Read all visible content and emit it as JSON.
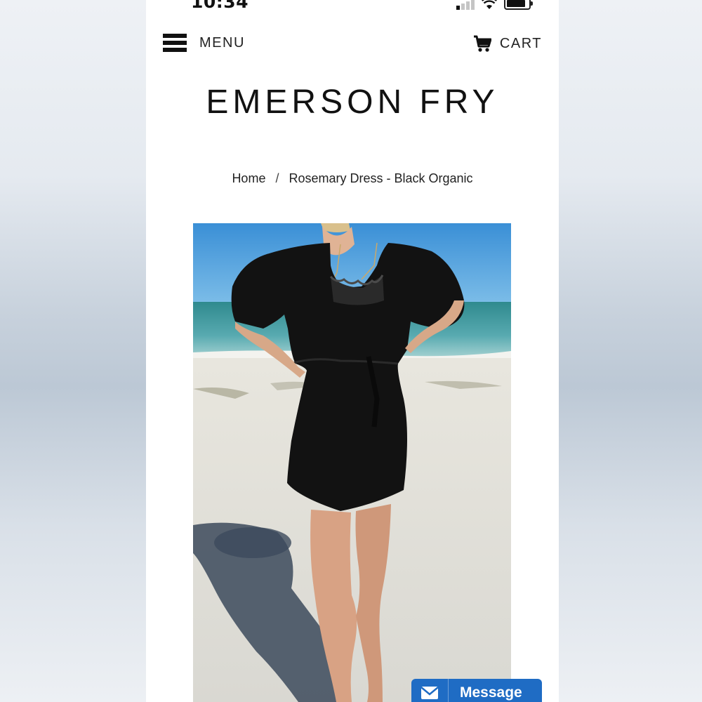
{
  "status_bar": {
    "time": "10:34"
  },
  "header": {
    "menu_label": "MENU",
    "cart_label": "CART"
  },
  "brand": {
    "logo_text": "EMERSON FRY"
  },
  "breadcrumb": {
    "home": "Home",
    "separator": "/",
    "current": "Rosemary Dress - Black Organic"
  },
  "chat": {
    "message_label": "Message"
  },
  "icons": {
    "menu": "hamburger-icon",
    "cart": "cart-icon",
    "message": "envelope-icon",
    "signal": "signal-icon",
    "wifi": "wifi-icon",
    "battery": "battery-icon"
  },
  "colors": {
    "accent": "#1f6cc4",
    "text": "#111111",
    "background": "#ffffff"
  }
}
